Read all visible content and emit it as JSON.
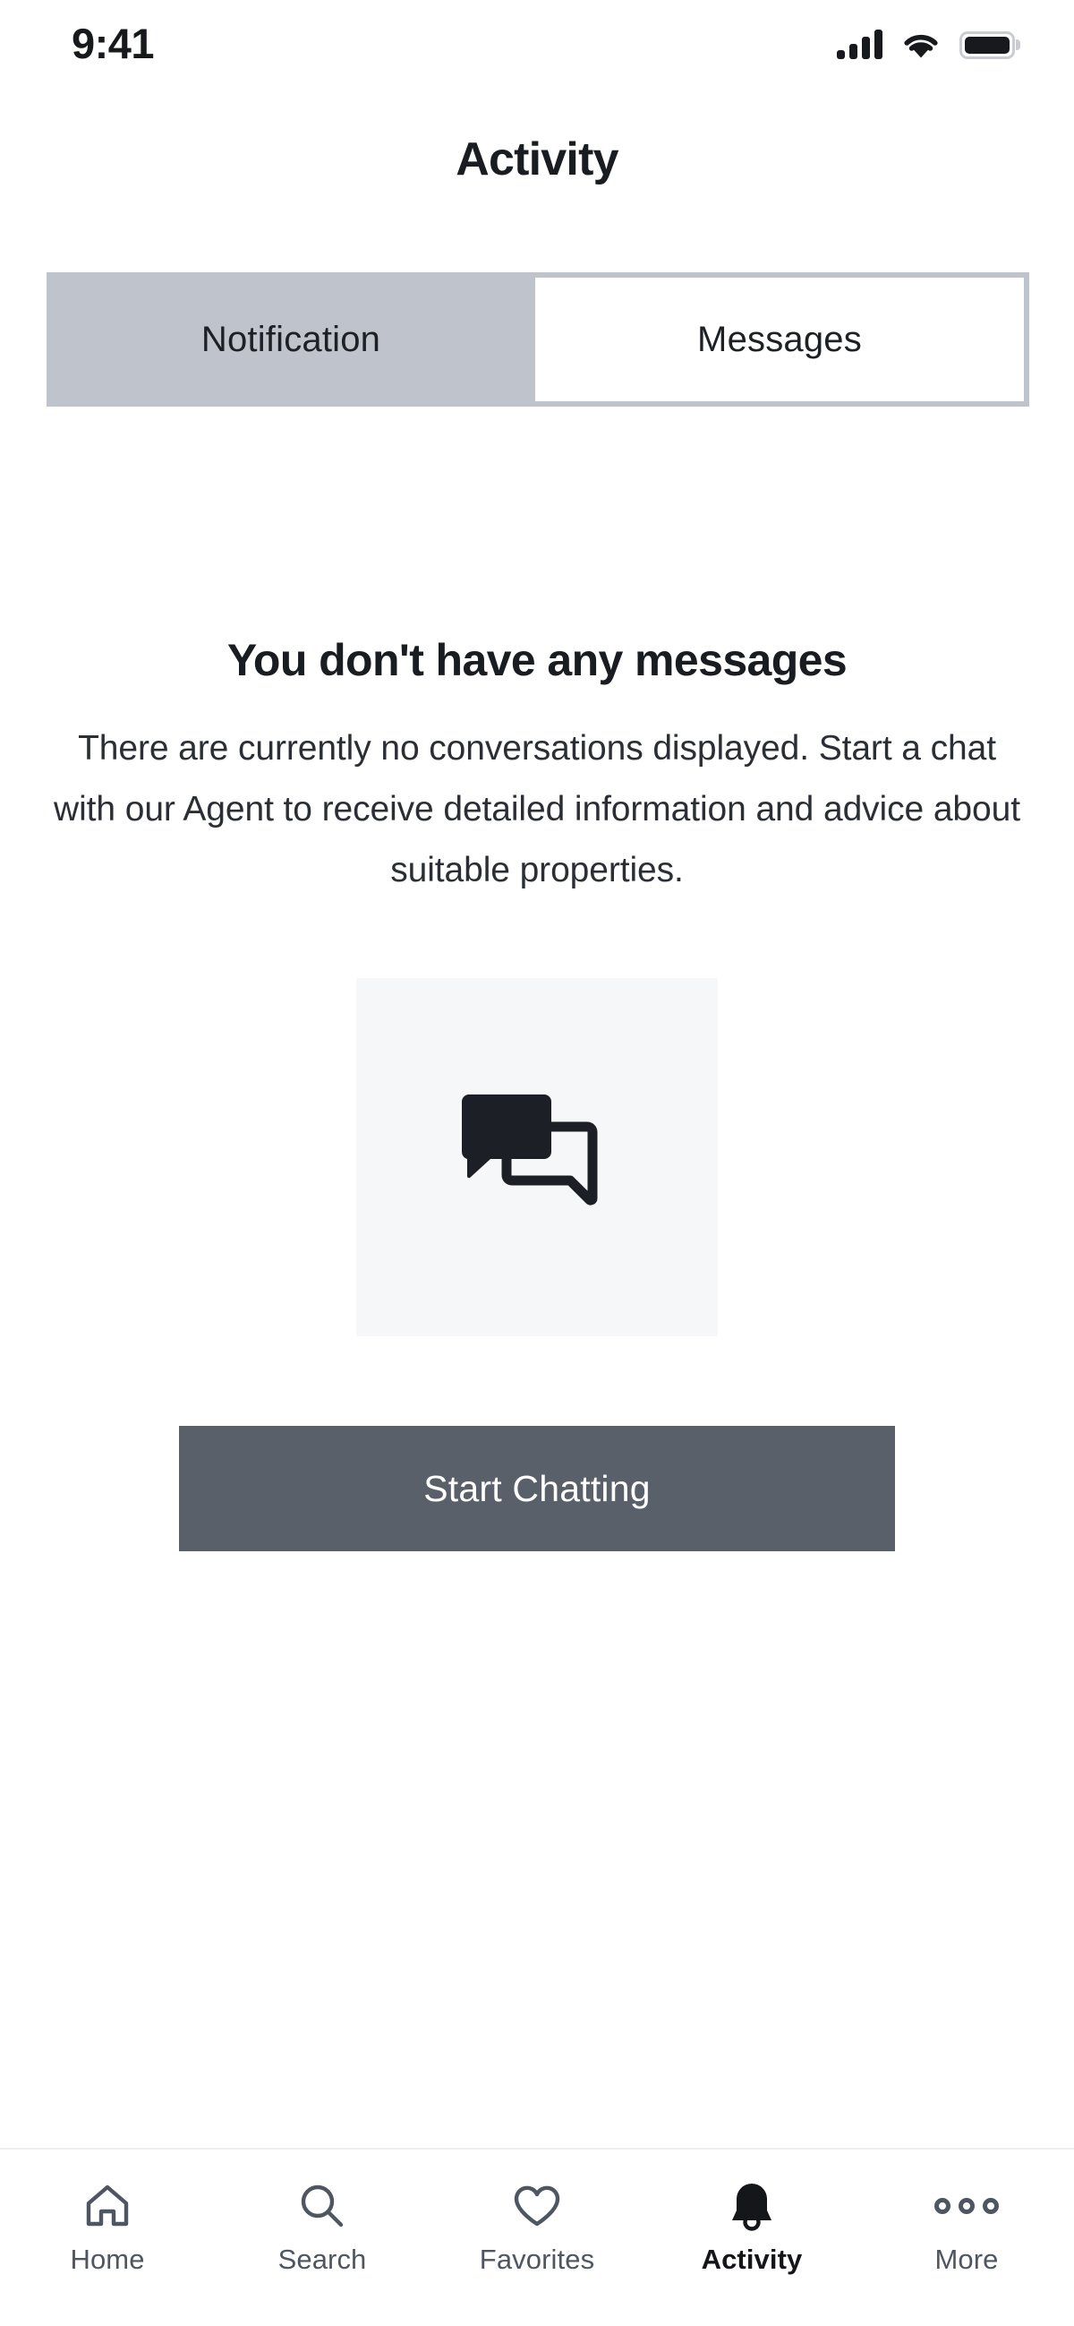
{
  "status_bar": {
    "time": "9:41",
    "cellular_icon": "cellular-signal-icon",
    "cellular_bars": 4,
    "wifi_icon": "wifi-icon",
    "battery_icon": "battery-full-icon"
  },
  "header": {
    "title": "Activity"
  },
  "tabs": {
    "items": [
      {
        "label": "Notification",
        "active": false
      },
      {
        "label": "Messages",
        "active": true
      }
    ],
    "inactive_bg": "#BEC3CC",
    "active_bg": "#FFFFFF"
  },
  "empty_state": {
    "title": "You don't have any messages",
    "description": "There are currently no conversations displayed. Start a chat with our Agent to receive detailed information and advice about suitable properties.",
    "illustration_icon": "chat-bubbles-icon",
    "illustration_bg": "#F6F7F9",
    "cta_label": "Start Chatting",
    "cta_bg": "#5A6069",
    "cta_text_color": "#FFFFFF"
  },
  "bottom_nav": {
    "items": [
      {
        "label": "Home",
        "icon": "home-icon",
        "active": false
      },
      {
        "label": "Search",
        "icon": "search-icon",
        "active": false
      },
      {
        "label": "Favorites",
        "icon": "heart-icon",
        "active": false
      },
      {
        "label": "Activity",
        "icon": "bell-icon",
        "active": true
      },
      {
        "label": "More",
        "icon": "more-dots-icon",
        "active": false
      }
    ],
    "inactive_color": "#4E5662",
    "active_color": "#14161A"
  }
}
